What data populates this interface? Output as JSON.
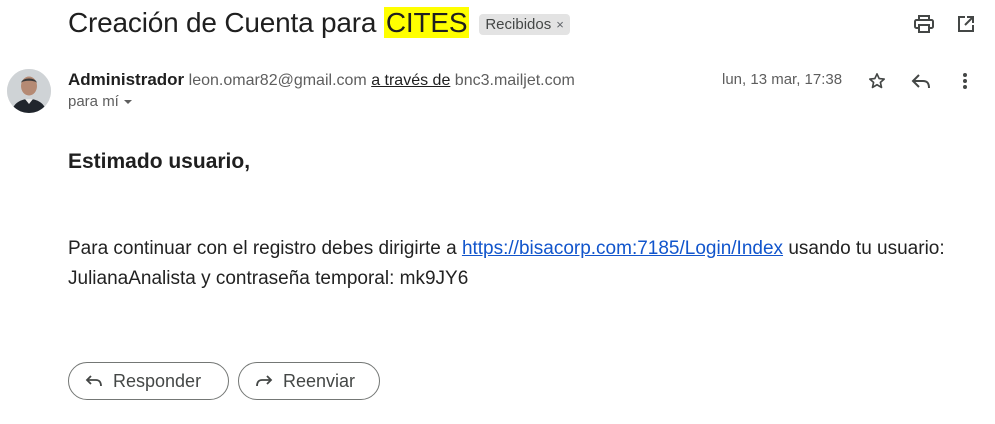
{
  "subject": {
    "prefix": "Creación de Cuenta para",
    "highlight": "CITES",
    "label": "Recibidos",
    "label_close": "×"
  },
  "top_actions": {
    "print_icon": "print-icon",
    "open_new_window_icon": "open-in-new-icon"
  },
  "sender": {
    "name": "Administrador",
    "email": "leon.omar82@gmail.com",
    "via_text": "a través de",
    "via_domain": "bnc3.mailjet.com",
    "recipient": "para mí"
  },
  "date": "lun, 13 mar, 17:38",
  "header_actions": {
    "star_icon": "star-icon",
    "reply_icon": "reply-icon",
    "more_icon": "more-vert-icon"
  },
  "body": {
    "greeting": "Estimado usuario,",
    "text_before_link": "Para continuar con el registro debes dirigirte a",
    "link": "https://bisacorp.com:7185/Login/Index",
    "text_after_link": "usando tu usuario: JulianaAnalista y contraseña temporal: mk9JY6"
  },
  "buttons": {
    "reply": "Responder",
    "forward": "Reenviar"
  },
  "colors": {
    "highlight": "#ffff00",
    "link": "#1155cc",
    "chip_bg": "#e3e3e3"
  }
}
